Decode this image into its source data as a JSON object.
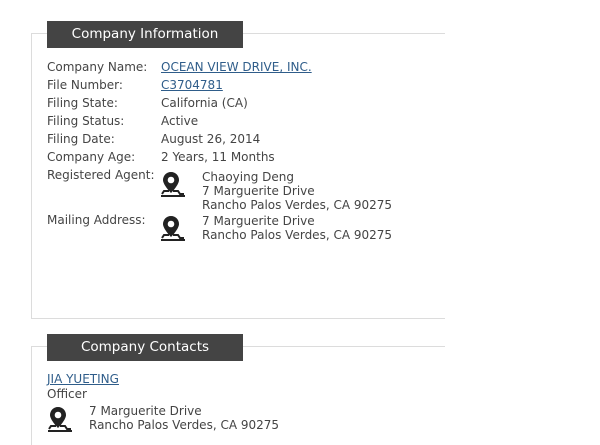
{
  "company_info": {
    "header": "Company Information",
    "fields": [
      {
        "label": "Company Name:",
        "value": "OCEAN VIEW DRIVE, INC."
      },
      {
        "label": "File Number:",
        "value": "C3704781"
      },
      {
        "label": "Filing State:",
        "value": "California (CA)"
      },
      {
        "label": "Filing Status:",
        "value": "Active"
      },
      {
        "label": "Filing Date:",
        "value": "August 26, 2014"
      },
      {
        "label": "Company Age:",
        "value": "2 Years, 11 Months"
      }
    ],
    "registered_agent": {
      "label": "Registered Agent:",
      "name": "Chaoying Deng",
      "line1": "7 Marguerite Drive",
      "line2": "Rancho Palos Verdes, CA 90275"
    },
    "mailing_address": {
      "label": "Mailing Address:",
      "line1": "7 Marguerite Drive",
      "line2": "Rancho Palos Verdes, CA 90275"
    }
  },
  "company_contacts": {
    "header": "Company Contacts",
    "contacts": [
      {
        "name": "JIA YUETING",
        "role": "Officer",
        "line1": "7 Marguerite Drive",
        "line2": "Rancho Palos Verdes, CA 90275"
      }
    ]
  },
  "colors": {
    "header_bg": "#444444",
    "link": "#2f5d8a",
    "text": "#444444"
  },
  "icons": {
    "location": "map-pin-icon"
  }
}
